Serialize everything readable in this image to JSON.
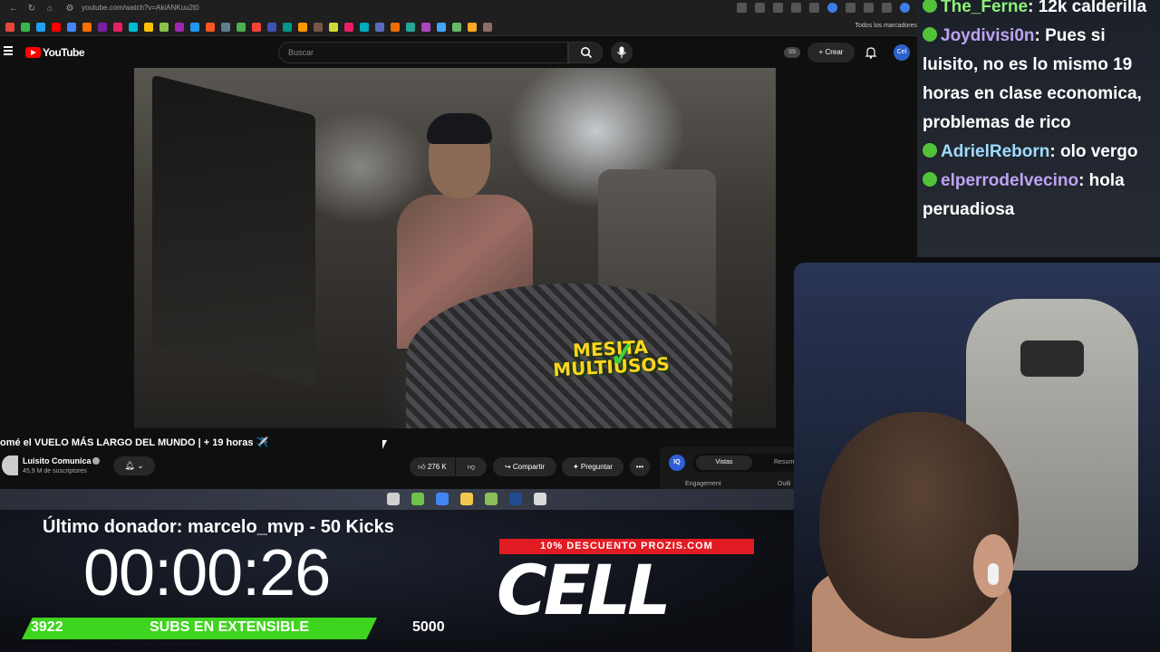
{
  "browser": {
    "url": "youtube.com/watch?v=AkiANKuu2t0",
    "bookmarks_all_label": "Todos los marcadores",
    "bookmark_icons": [
      "#e7453c",
      "#3ab54a",
      "#1da1f2",
      "#ff0000",
      "#4285f4",
      "#ff6d00",
      "#7b1fa2",
      "#e91e63",
      "#00bcd4",
      "#ffc107",
      "#8bc34a",
      "#9c27b0",
      "#2196f3",
      "#ff5722",
      "#607d8b",
      "#4caf50",
      "#f44336",
      "#3f51b5",
      "#009688",
      "#ff9800",
      "#795548",
      "#cddc39",
      "#e91e63",
      "#00acc1",
      "#5c6bc0",
      "#ef6c00",
      "#26a69a",
      "#ab47bc",
      "#42a5f5",
      "#66bb6a",
      "#ffa726",
      "#8d6e63"
    ]
  },
  "youtube": {
    "logo_text": "YouTube",
    "search_placeholder": "Buscar",
    "ss_badge": "SS",
    "create_label": "+ Crear",
    "avatar_text": "Cel",
    "video": {
      "overlay_text": "MESITA MULTIUSOS",
      "title": "omé el VUELO MÁS LARGO DEL MUNDO | + 19 horas ✈️",
      "channel_name": "Luisito Comunica",
      "subscribers": "45,9 M de suscriptores",
      "likes": "276 K",
      "share_label": "Compartir",
      "ask_label": "Preguntar",
      "more_label": "•••"
    },
    "stats_panel": {
      "logo_text": "IQ",
      "tab_active": "Vistas",
      "tab_other": "Resum",
      "engagement_label": "Engagement",
      "outlier_label": "Outli"
    }
  },
  "taskbar": {
    "icons": [
      "#cfcfcf",
      "#6cc24a",
      "#4285f4",
      "#f2c94c",
      "#8bbf5a",
      "#1f4c8f",
      "#d9d9d9"
    ]
  },
  "stream_overlay": {
    "donor_text": "Último donador: marcelo_mvp - 50 Kicks",
    "timer": "00:00:26",
    "subs_current": "3922",
    "subs_label": "SUBS EN EXTENSIBLE",
    "subs_goal": "5000",
    "promo_banner": "10% DESCUENTO PROZIS.COM",
    "promo_word": "CELL"
  },
  "chat": {
    "messages": [
      {
        "user": "The_Ferne",
        "text": ": 12k calderilla",
        "color_class": "green"
      },
      {
        "user": "Joydivisi0n",
        "text": ": Pues si luisito, no es lo mismo 19 horas en clase economica, problemas de rico",
        "color_class": ""
      },
      {
        "user": "AdrielReborn",
        "text": ": olo vergo",
        "color_class": "blue"
      },
      {
        "user": "elperrodelvecino",
        "text": ": hola peruadiosa",
        "color_class": ""
      }
    ]
  }
}
